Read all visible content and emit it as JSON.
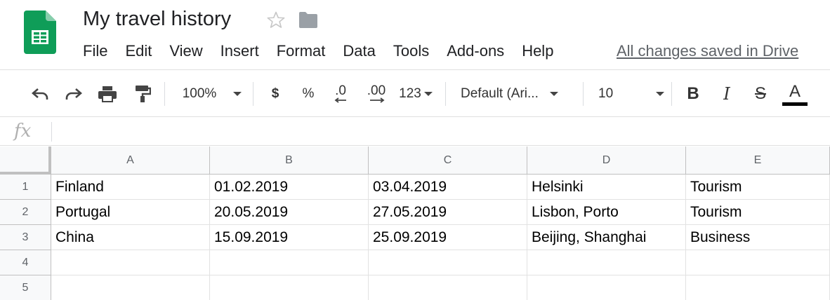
{
  "document": {
    "title": "My travel history",
    "status": "All changes saved in Drive"
  },
  "icons": {
    "app": "google-sheets-icon",
    "star": "star-icon",
    "folder": "folder-icon"
  },
  "menu": [
    "File",
    "Edit",
    "View",
    "Insert",
    "Format",
    "Data",
    "Tools",
    "Add-ons",
    "Help"
  ],
  "toolbar": {
    "zoom": "100%",
    "currency": "$",
    "percent": "%",
    "decrease_decimal": ".0",
    "increase_decimal": ".00",
    "more_formats": "123",
    "font": "Default (Ari...",
    "font_size": "10",
    "bold": "B",
    "italic": "I",
    "strikethrough": "S",
    "text_color": "A"
  },
  "formula_bar": {
    "fx": "fx",
    "value": ""
  },
  "colors": {
    "sheets_green": "#0F9D58",
    "text_color_bar": "#000000"
  },
  "sheet": {
    "columns": [
      "A",
      "B",
      "C",
      "D",
      "E"
    ],
    "row_numbers": [
      "1",
      "2",
      "3",
      "4",
      "5"
    ],
    "rows": [
      [
        "Finland",
        "01.02.2019",
        "03.04.2019",
        "Helsinki",
        "Tourism"
      ],
      [
        "Portugal",
        "20.05.2019",
        "27.05.2019",
        "Lisbon, Porto",
        "Tourism"
      ],
      [
        "China",
        "15.09.2019",
        "25.09.2019",
        "Beijing, Shanghai",
        "Business"
      ],
      [
        "",
        "",
        "",
        "",
        ""
      ],
      [
        "",
        "",
        "",
        "",
        ""
      ]
    ]
  }
}
